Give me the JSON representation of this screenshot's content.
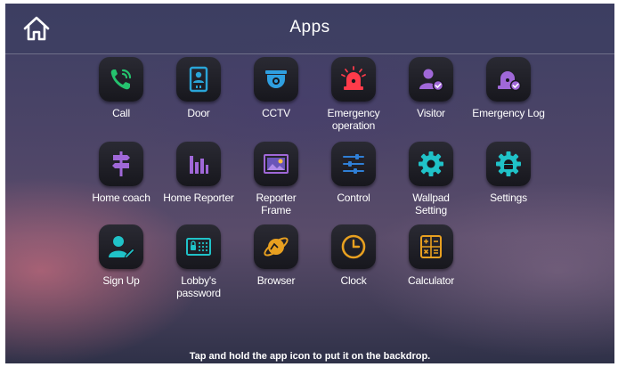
{
  "header": {
    "title": "Apps",
    "home_icon": "home-icon"
  },
  "apps": [
    {
      "label": "Call",
      "icon": "phone-icon"
    },
    {
      "label": "Door",
      "icon": "door-phone-icon"
    },
    {
      "label": "CCTV",
      "icon": "cctv-camera-icon"
    },
    {
      "label": "Emergency\noperation",
      "icon": "alarm-siren-icon"
    },
    {
      "label": "Visitor",
      "icon": "visitor-icon"
    },
    {
      "label": "Emergency Log",
      "icon": "emergency-log-icon"
    },
    {
      "label": "Home coach",
      "icon": "signpost-icon"
    },
    {
      "label": "Home Reporter",
      "icon": "bar-chart-icon"
    },
    {
      "label": "Reporter\nFrame",
      "icon": "picture-frame-icon"
    },
    {
      "label": "Control",
      "icon": "sliders-icon"
    },
    {
      "label": "Wallpad\nSetting",
      "icon": "gear-icon"
    },
    {
      "label": "Settings",
      "icon": "android-gear-icon"
    },
    {
      "label": "Sign Up",
      "icon": "user-edit-icon"
    },
    {
      "label": "Lobby's\npassword",
      "icon": "lock-keypad-icon"
    },
    {
      "label": "Browser",
      "icon": "planet-icon"
    },
    {
      "label": "Clock",
      "icon": "clock-icon"
    },
    {
      "label": "Calculator",
      "icon": "calculator-icon"
    }
  ],
  "footer": {
    "hint": "Tap and hold the app icon to put it on the backdrop."
  },
  "colors": {
    "call": "#25c26e",
    "door": "#2aa5d8",
    "cctv": "#2f9fe0",
    "emergency": "#ff3b4a",
    "visitor": "#a068d8",
    "log": "#a068d8",
    "coach": "#a068d8",
    "reporter": "#a068d8",
    "control": "#2f7fd6",
    "gear": "#20c2c8",
    "browser": "#e8a020",
    "clock": "#e8a020",
    "calculator": "#e8a020"
  }
}
